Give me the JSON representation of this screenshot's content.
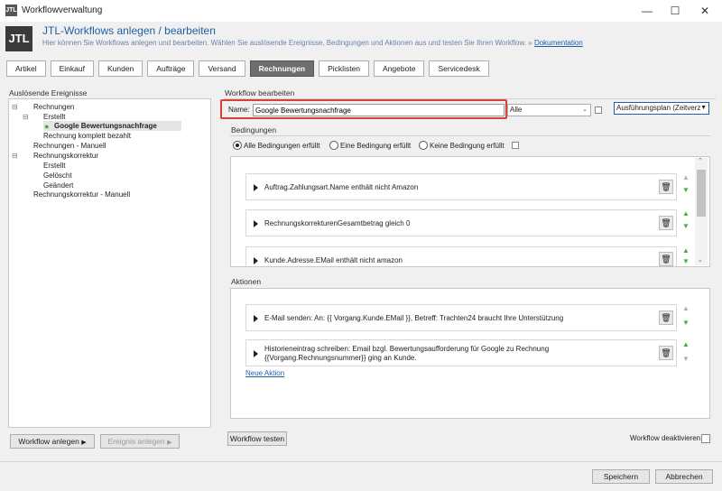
{
  "window": {
    "title": "Workflowverwaltung",
    "logo": "JTL"
  },
  "header": {
    "title": "JTL-Workflows anlegen / bearbeiten",
    "subtitle": "Hier können Sie Workflows anlegen und bearbeiten. Wählen Sie auslösende Ereignisse, Bedingungen und Aktionen aus und testen Sie Ihren Workflow. »",
    "doc_link": "Dokumentation"
  },
  "tabs": [
    "Artikel",
    "Einkauf",
    "Kunden",
    "Aufträge",
    "Versand",
    "Rechnungen",
    "Picklisten",
    "Angebote",
    "Servicedesk"
  ],
  "events": {
    "label": "Auslösende Ereignisse",
    "tree": [
      "Rechnungen",
      "Erstellt",
      "Google Bewertungsnachfrage",
      "Rechnung komplett bezahlt",
      "Rechnungen - Manuell",
      "Rechnungskorrektur",
      "Erstellt",
      "Gelöscht",
      "Geändert",
      "Rechnungskorrektur - Manuell"
    ],
    "btn_create_workflow": "Workflow anlegen",
    "btn_create_event": "Ereignis anlegen"
  },
  "editor": {
    "label": "Workflow bearbeiten",
    "name_label": "Name:",
    "name_value": "Google Bewertungsnachfrage",
    "filter_value": "Alle",
    "plan_button": "Ausführungsplan (Zeitverz",
    "conditions_label": "Bedingungen",
    "radio_all": "Alle Bedingungen erfüllt",
    "radio_one": "Eine Bedingung erfüllt",
    "radio_none": "Keine Bedingung erfüllt",
    "conditions": [
      "Auftrag.Zahlungsart.Name enthält nicht Amazon",
      "RechnungskorrekturenGesamtbetrag gleich 0",
      "Kunde.Adresse.EMail enthält nicht amazon"
    ],
    "actions_label": "Aktionen",
    "actions": [
      "E-Mail senden: An: {{ Vorgang.Kunde.EMail }}, Betreff: Trachten24 braucht Ihre Unterstützung",
      "Historieneintrag schreiben: Email bzgl. Bewertungsaufforderung für Google zu Rechnung",
      "{{Vorgang.Rechnungsnummer}} ging an Kunde."
    ],
    "new_action_link": "Neue Aktion",
    "test_button": "Workflow testen",
    "deactivate_label": "Workflow deaktivieren"
  },
  "footer": {
    "save": "Speichern",
    "cancel": "Abbrechen"
  },
  "colors": {
    "highlight": "#d9403a",
    "link": "#1f5fa8",
    "accent": "#4aa84a"
  }
}
